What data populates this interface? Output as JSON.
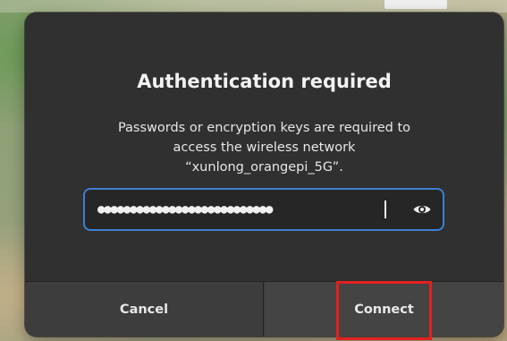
{
  "dialog": {
    "title": "Authentication required",
    "message_lines": [
      "Passwords or encryption keys are required to",
      "access the wireless network",
      "“xunlong_orangepi_5G”."
    ],
    "password": {
      "masked_value": "●●●●●●●●●●●●●●●●●●●●●●●●●●●",
      "reveal_icon": "eye-icon",
      "focus_color": "#3d7fd1"
    },
    "buttons": {
      "cancel_label": "Cancel",
      "connect_label": "Connect"
    }
  },
  "annotation": {
    "highlight_color": "#e52020",
    "highlight_target": "connect-button"
  },
  "colors": {
    "dialog_bg": "#303030",
    "button_bar_bg": "#3d3d3d",
    "text": "#f2f2f2"
  }
}
